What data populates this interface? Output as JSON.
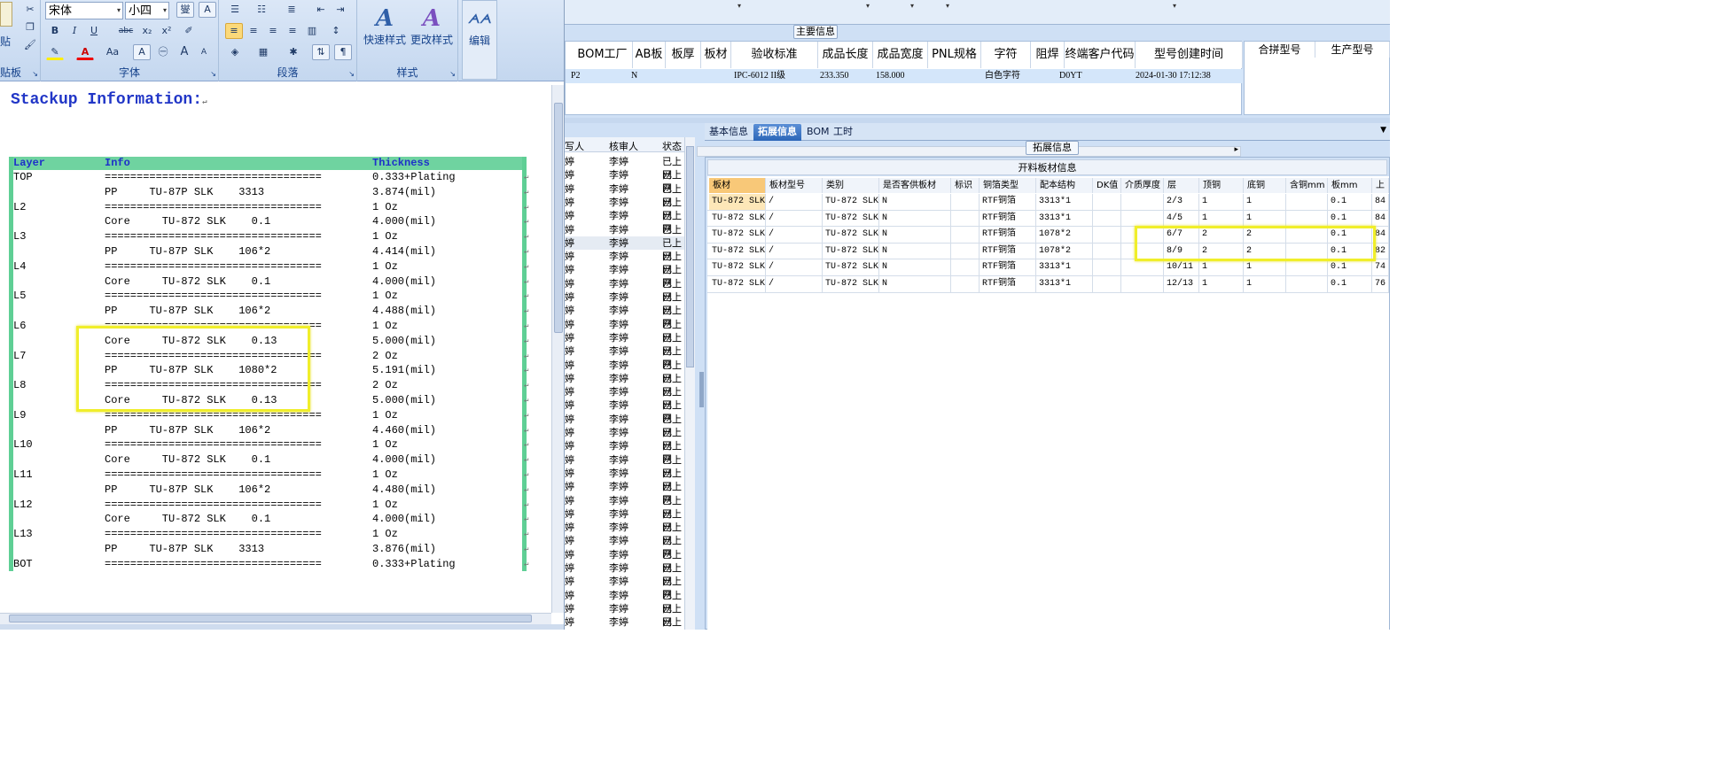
{
  "ribbon": {
    "clipboard": {
      "paste_label": "贴",
      "group_label": "贴板"
    },
    "font": {
      "font_name": "宋体",
      "font_size": "小四",
      "bold": "B",
      "italic": "I",
      "underline": "U",
      "strike": "abc",
      "subscript": "x₂",
      "superscript": "x²",
      "text_color": "A",
      "char_case": "Aa",
      "grow": "A",
      "shrink": "A",
      "group_label": "字体"
    },
    "paragraph": {
      "group_label": "段落"
    },
    "styles": {
      "quick_styles": "快速样式",
      "change_styles": "更改样式",
      "group_label": "样式"
    },
    "editing": {
      "label": "编辑"
    }
  },
  "document": {
    "title": "Stackup Information:",
    "headers": {
      "layer": "Layer",
      "info": "Info",
      "thickness": "Thickness"
    },
    "rows": [
      {
        "layer": "TOP",
        "info": "==================================",
        "thickness": "0.333+Plating"
      },
      {
        "layer": "",
        "info": "PP     TU-87P SLK    3313",
        "thickness": "3.874(mil)"
      },
      {
        "layer": "L2",
        "info": "==================================",
        "thickness": "1 Oz"
      },
      {
        "layer": "",
        "info": "Core     TU-872 SLK    0.1",
        "thickness": "4.000(mil)"
      },
      {
        "layer": "L3",
        "info": "==================================",
        "thickness": "1 Oz"
      },
      {
        "layer": "",
        "info": "PP     TU-87P SLK    106*2",
        "thickness": "4.414(mil)"
      },
      {
        "layer": "L4",
        "info": "==================================",
        "thickness": "1 Oz"
      },
      {
        "layer": "",
        "info": "Core     TU-872 SLK    0.1",
        "thickness": "4.000(mil)"
      },
      {
        "layer": "L5",
        "info": "==================================",
        "thickness": "1 Oz"
      },
      {
        "layer": "",
        "info": "PP     TU-87P SLK    106*2",
        "thickness": "4.488(mil)"
      },
      {
        "layer": "L6",
        "info": "==================================",
        "thickness": "1 Oz"
      },
      {
        "layer": "",
        "info": "Core     TU-872 SLK    0.13",
        "thickness": "5.000(mil)"
      },
      {
        "layer": "L7",
        "info": "==================================",
        "thickness": "2 Oz"
      },
      {
        "layer": "",
        "info": "PP     TU-87P SLK    1080*2",
        "thickness": "5.191(mil)"
      },
      {
        "layer": "L8",
        "info": "==================================",
        "thickness": "2 Oz"
      },
      {
        "layer": "",
        "info": "Core     TU-872 SLK    0.13",
        "thickness": "5.000(mil)"
      },
      {
        "layer": "L9",
        "info": "==================================",
        "thickness": "1 Oz"
      },
      {
        "layer": "",
        "info": "PP     TU-87P SLK    106*2",
        "thickness": "4.460(mil)"
      },
      {
        "layer": "L10",
        "info": "==================================",
        "thickness": "1 Oz"
      },
      {
        "layer": "",
        "info": "Core     TU-872 SLK    0.1",
        "thickness": "4.000(mil)"
      },
      {
        "layer": "L11",
        "info": "==================================",
        "thickness": "1 Oz"
      },
      {
        "layer": "",
        "info": "PP     TU-87P SLK    106*2",
        "thickness": "4.480(mil)"
      },
      {
        "layer": "L12",
        "info": "==================================",
        "thickness": "1 Oz"
      },
      {
        "layer": "",
        "info": "Core     TU-872 SLK    0.1",
        "thickness": "4.000(mil)"
      },
      {
        "layer": "L13",
        "info": "==================================",
        "thickness": "1 Oz"
      },
      {
        "layer": "",
        "info": "PP     TU-87P SLK    3313",
        "thickness": "3.876(mil)"
      },
      {
        "layer": "BOT",
        "info": "==================================",
        "thickness": "0.333+Plating"
      }
    ]
  },
  "erp": {
    "main_info_title": "主要信息",
    "main_headers": [
      "BOM工厂",
      "AB板",
      "板厚",
      "板材",
      "验收标准",
      "成品长度",
      "成品宽度",
      "PNL规格",
      "字符",
      "阻焊",
      "终端客户代码",
      "型号创建时间"
    ],
    "main_row": {
      "bom": "P2",
      "ab": "N",
      "standard": "IPC-6012 II级",
      "length": "233.350",
      "width": "158.000",
      "char": "白色字符",
      "customer": "D0YT",
      "created": "2024-01-30 17:12:38"
    },
    "merge_headers": [
      "合拼型号",
      "生产型号"
    ],
    "left_list": {
      "headers": [
        "写人",
        "核审人",
        "状态"
      ],
      "prefix": "婷",
      "reviewer": "李婷",
      "status": "已上网"
    },
    "tabs": [
      "基本信息",
      "拓展信息",
      "BOM",
      "工时"
    ],
    "active_tab": "拓展信息",
    "ext_title": "拓展信息",
    "ext_caption": "开料板材信息",
    "ext_headers": [
      "板材",
      "板材型号",
      "类别",
      "是否客供板材",
      "标识",
      "铜箔类型",
      "配本结构",
      "DK值",
      "介质厚度",
      "层",
      "顶铜",
      "底铜",
      "含铜mm",
      "板mm",
      "上"
    ],
    "ext_rows": [
      [
        "TU-872 SLK",
        "/",
        "TU-872 SLK",
        "N",
        "",
        "RTF铜箔",
        "3313*1",
        "",
        "",
        "2/3",
        "1",
        "1",
        "",
        "0.1",
        "84"
      ],
      [
        "TU-872 SLK",
        "/",
        "TU-872 SLK",
        "N",
        "",
        "RTF铜箔",
        "3313*1",
        "",
        "",
        "4/5",
        "1",
        "1",
        "",
        "0.1",
        "84"
      ],
      [
        "TU-872 SLK",
        "/",
        "TU-872 SLK",
        "N",
        "",
        "RTF铜箔",
        "1078*2",
        "",
        "",
        "6/7",
        "2",
        "2",
        "",
        "0.1",
        "84"
      ],
      [
        "TU-872 SLK",
        "/",
        "TU-872 SLK",
        "N",
        "",
        "RTF铜箔",
        "1078*2",
        "",
        "",
        "8/9",
        "2",
        "2",
        "",
        "0.1",
        "82"
      ],
      [
        "TU-872 SLK",
        "/",
        "TU-872 SLK",
        "N",
        "",
        "RTF铜箔",
        "3313*1",
        "",
        "",
        "10/11",
        "1",
        "1",
        "",
        "0.1",
        "74"
      ],
      [
        "TU-872 SLK",
        "/",
        "TU-872 SLK",
        "N",
        "",
        "RTF铜箔",
        "3313*1",
        "",
        "",
        "12/13",
        "1",
        "1",
        "",
        "0.1",
        "76"
      ]
    ]
  }
}
